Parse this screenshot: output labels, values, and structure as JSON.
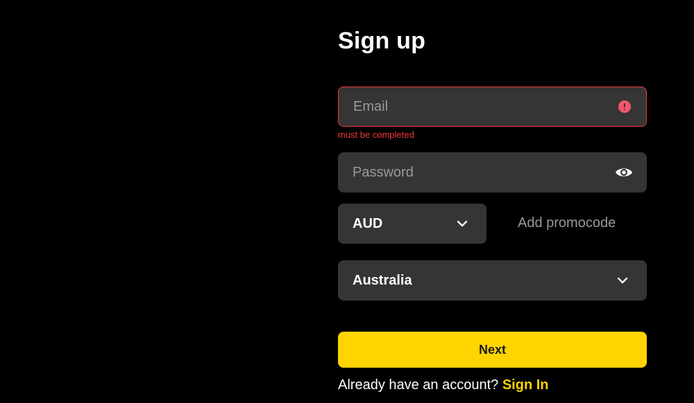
{
  "signup": {
    "title": "Sign up",
    "email": {
      "placeholder": "Email",
      "value": "",
      "error": "must be completed",
      "status_icon": "error-icon"
    },
    "password": {
      "placeholder": "Password",
      "value": "",
      "toggle_icon": "eye-icon"
    },
    "currency": {
      "selected": "AUD"
    },
    "promocode_label": "Add promocode",
    "country": {
      "selected": "Australia"
    },
    "next_label": "Next",
    "signin_prompt": "Already have an account?",
    "signin_link": "Sign In"
  },
  "colors": {
    "background": "#000000",
    "field_bg": "#353535",
    "accent": "#ffd400",
    "error": "#f23a3a"
  }
}
